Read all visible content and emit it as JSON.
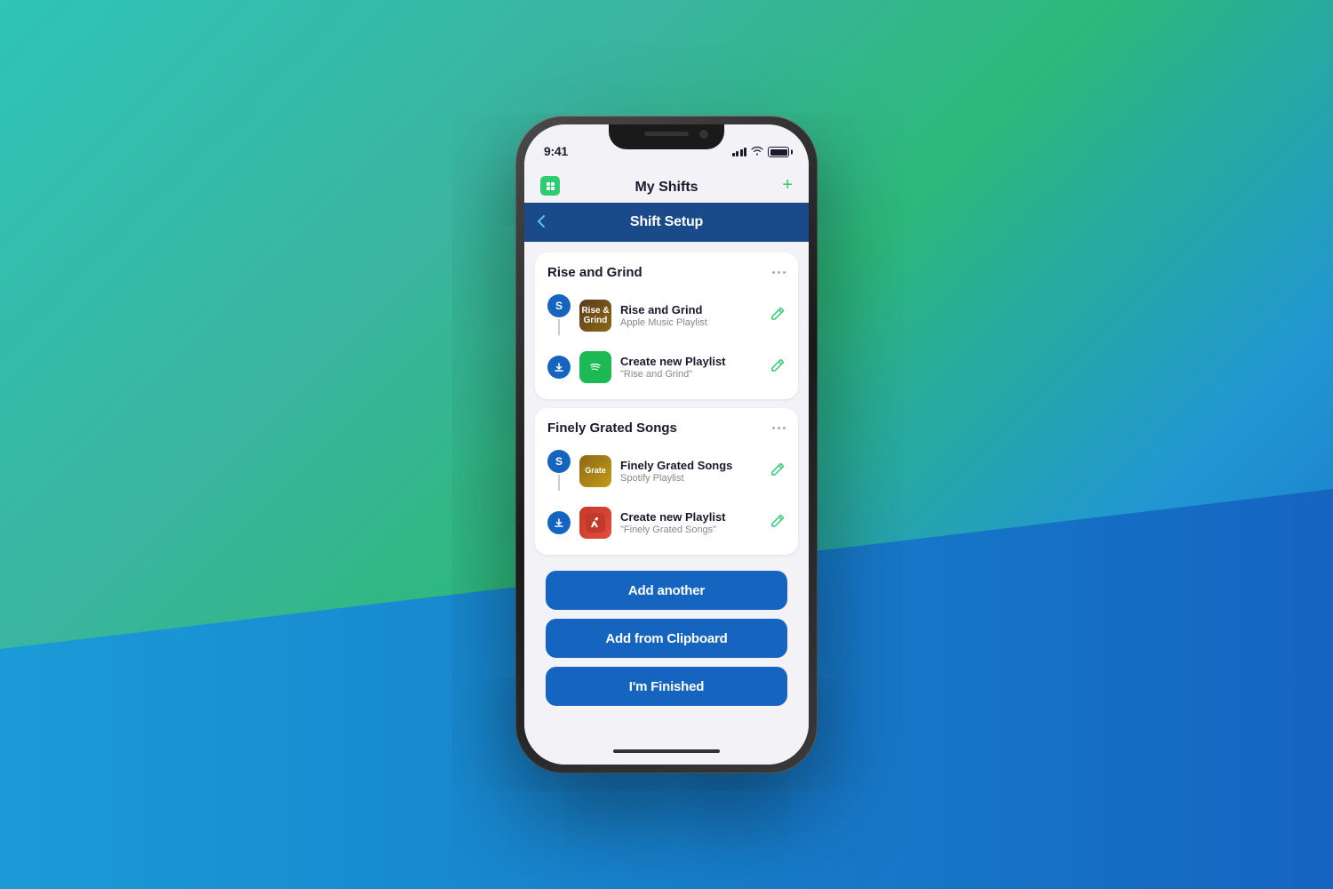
{
  "background": {
    "colors": [
      "#2ec4b6",
      "#3ab87a",
      "#1565c0"
    ]
  },
  "phone": {
    "status_bar": {
      "time": "9:41",
      "signal_bars": [
        4,
        6,
        8,
        10,
        12
      ],
      "battery_percent": 100
    },
    "behind_nav": {
      "title": "My Shifts",
      "add_label": "+"
    },
    "nav_bar": {
      "title": "Shift Setup",
      "back_label": "‹"
    },
    "cards": [
      {
        "id": "rise-and-grind",
        "title": "Rise and Grind",
        "items": [
          {
            "step_type": "source",
            "step_letter": "S",
            "app": "apple_music",
            "item_title": "Rise and Grind",
            "item_subtitle": "Apple Music Playlist"
          },
          {
            "step_type": "destination",
            "step_letter": "↓",
            "app": "spotify",
            "item_title": "Create new Playlist",
            "item_subtitle": "\"Rise and Grind\""
          }
        ]
      },
      {
        "id": "finely-grated-songs",
        "title": "Finely Grated Songs",
        "items": [
          {
            "step_type": "source",
            "step_letter": "S",
            "app": "spotify",
            "item_title": "Finely Grated Songs",
            "item_subtitle": "Spotify Playlist"
          },
          {
            "step_type": "destination",
            "step_letter": "↓",
            "app": "apple_music_red",
            "item_title": "Create new Playlist",
            "item_subtitle": "\"Finely Grated Songs\""
          }
        ]
      }
    ],
    "buttons": [
      {
        "id": "add-another",
        "label": "Add another"
      },
      {
        "id": "add-from-clipboard",
        "label": "Add from Clipboard"
      },
      {
        "id": "im-finished",
        "label": "I'm Finished"
      }
    ],
    "more_options_label": "•••",
    "edit_icon": "✎"
  }
}
